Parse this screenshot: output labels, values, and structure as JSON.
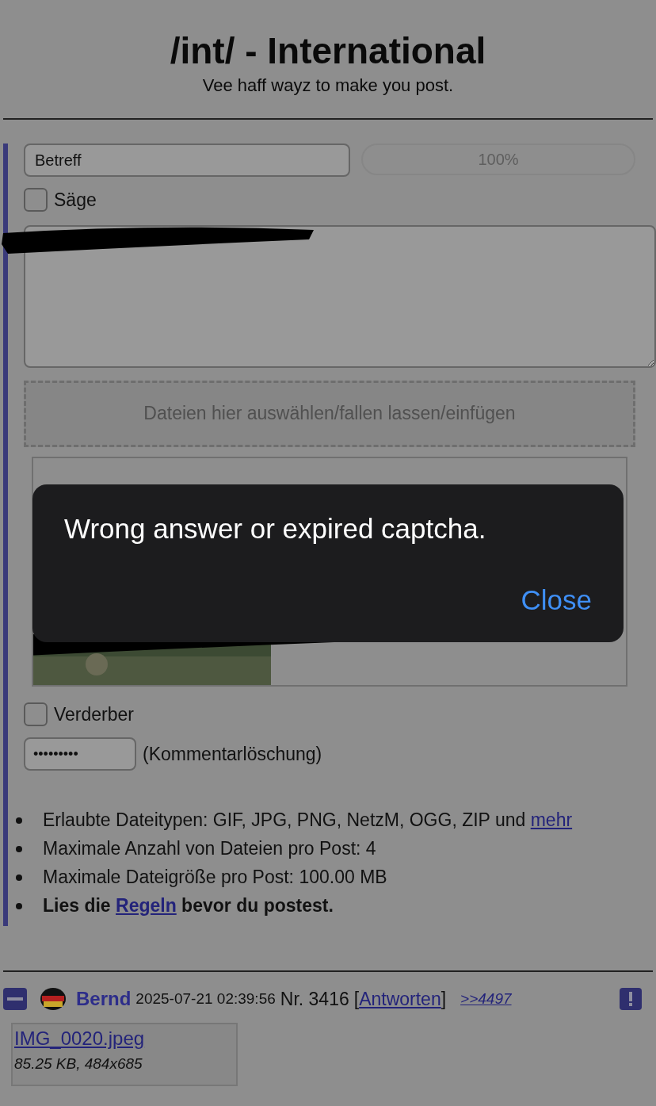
{
  "header": {
    "title": "/int/ - International",
    "subtitle": "Vee haff wayz to make you post."
  },
  "form": {
    "subject": {
      "placeholder": "Betreff"
    },
    "progress": {
      "text": "100%"
    },
    "sage": {
      "label": "Säge",
      "checked": false
    },
    "dropzone": "Dateien hier auswählen/fallen lassen/einfügen",
    "spoiler": {
      "label": "Verderber",
      "checked": false
    },
    "password": {
      "value": "•••••••••",
      "label": "(Kommentarlöschung)"
    },
    "rules": [
      {
        "text": "Erlaubte Dateitypen: GIF, JPG, PNG, NetzM, OGG, ZIP und",
        "link": "mehr",
        "bold": false
      },
      {
        "text": "Maximale Anzahl von Dateien pro Post: 4",
        "bold": false
      },
      {
        "text": "Maximale Dateigröße pro Post: 100.00 MB",
        "bold": false
      },
      {
        "text": "Lies die",
        "link": "Regeln",
        "after": "bevor du postest.",
        "bold": true
      }
    ]
  },
  "post": {
    "name": "Bernd",
    "date": "2025-07-21 02:39:56",
    "number": "Nr. 3416",
    "open_bracket": "[",
    "reply": "Antworten",
    "close_bracket": "]",
    "backlink": ">>4497",
    "file": {
      "name": "IMG_0020.jpeg",
      "info": "85.25 KB, 484x685"
    }
  },
  "dialog": {
    "message": "Wrong answer or expired captcha.",
    "button": "Close"
  }
}
